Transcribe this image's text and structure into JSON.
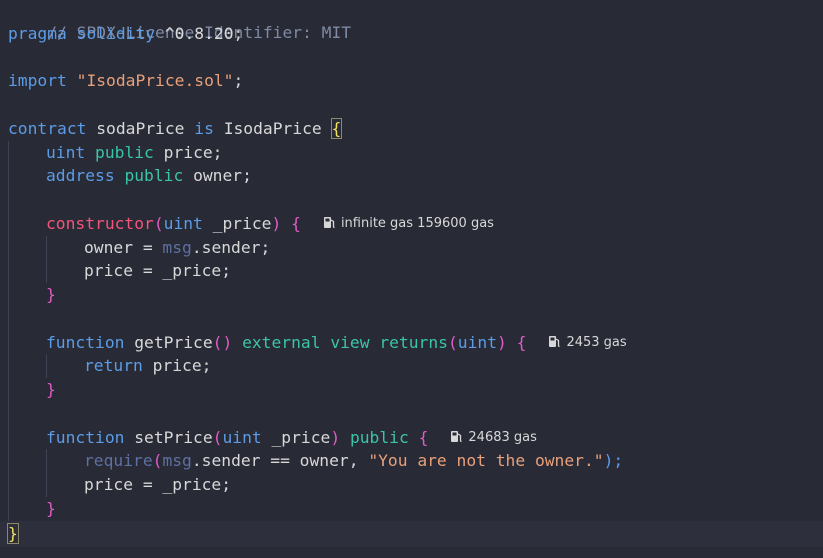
{
  "code": {
    "license_comment": "// SPDX-License-Identifier: MIT",
    "pragma_kw": "pragma",
    "pragma_name": "solidity",
    "pragma_version": "^0.8.20;",
    "import_kw": "import",
    "import_path": "\"IsodaPrice.sol\"",
    "import_end": ";",
    "contract_kw": "contract",
    "contract_name": "sodaPrice",
    "is_kw": "is",
    "interface_name": "IsodaPrice",
    "open_brace": "{",
    "close_brace": "}",
    "uint_kw": "uint",
    "address_kw": "address",
    "public_kw": "public",
    "price_decl": "price;",
    "owner_decl": "owner;",
    "constructor_kw": "constructor",
    "paren_open": "(",
    "paren_close": ")",
    "param_price": "_price",
    "owner_assign": "owner = ",
    "msg": "msg",
    "sender_stmt": ".sender;",
    "price_assign": "price = _price;",
    "function_kw": "function",
    "getprice_name": "getPrice",
    "empty_parens": "()",
    "external_kw": "external",
    "view_kw": "view",
    "returns_kw": "returns",
    "return_kw": "return",
    "return_stmt": "price;",
    "setprice_name": "setPrice",
    "require_kw": "require",
    "sender_eq": ".sender == owner, ",
    "require_msg": "\"You are not the owner.\"",
    "require_end": ");",
    "func_open": "{"
  },
  "gas_hints": {
    "constructor": "infinite gas 159600 gas",
    "getPrice": "2453 gas",
    "setPrice": "24683 gas"
  },
  "colors": {
    "background": "#282a36",
    "current_line": "#2d2f3d",
    "keyword": "#5c9ce6",
    "modifier": "#3bc4a8",
    "constructor": "#f2557a",
    "string": "#e8a07a",
    "comment": "#7f8aa3",
    "brace_yellow": "#f2e25d",
    "brace_pink": "#e05cc6"
  }
}
